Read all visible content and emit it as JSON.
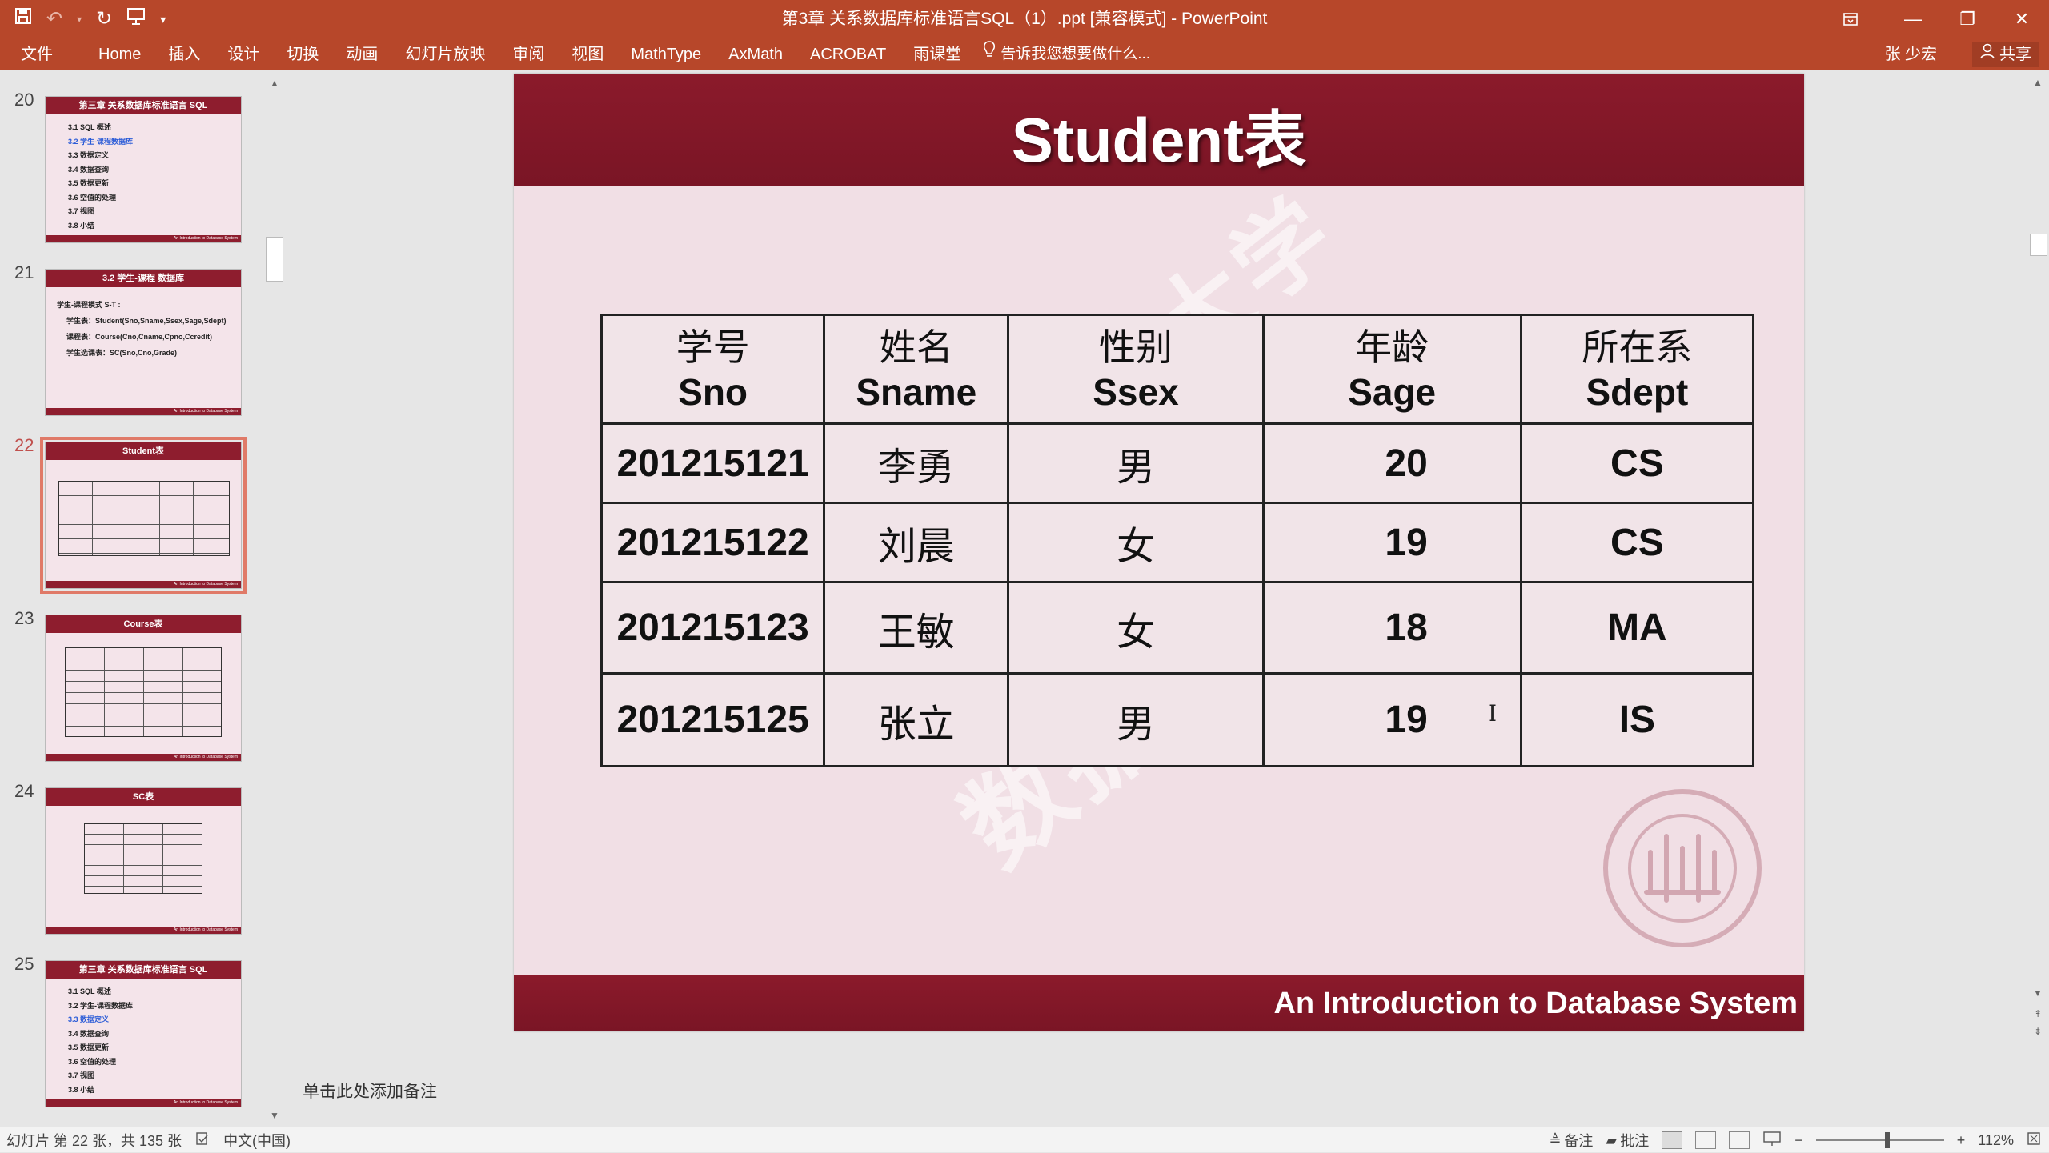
{
  "window": {
    "title": "第3章 关系数据库标准语言SQL（1）.ppt [兼容模式] - PowerPoint"
  },
  "quick_access": {
    "save": "save-icon",
    "undo": "undo-icon",
    "redo": "redo-icon",
    "present": "present-icon",
    "more": "▾"
  },
  "ribbon": {
    "tabs": [
      "文件",
      "Home",
      "插入",
      "设计",
      "切换",
      "动画",
      "幻灯片放映",
      "审阅",
      "视图",
      "MathType",
      "AxMath",
      "ACROBAT",
      "雨课堂"
    ],
    "tell_me": "告诉我您想要做什么...",
    "user": "张 少宏",
    "share": "共享"
  },
  "thumbnails": [
    {
      "number": "20",
      "title": "第三章 关系数据库标准语言 SQL",
      "lines": [
        "3.1 SQL 概述",
        "3.2 学生-课程数据库",
        "3.3 数据定义",
        "3.4 数据查询",
        "3.5 数据更新",
        "3.6 空值的处理",
        "3.7 视图",
        "3.8 小结"
      ],
      "highlight": 1
    },
    {
      "number": "21",
      "title": "3.2 学生-课程 数据库",
      "lines": [
        "学生-课程模式 S-T :",
        "学生表：Student(Sno,Sname,Ssex,Sage,Sdept)",
        "课程表：Course(Cno,Cname,Cpno,Ccredit)",
        "学生选课表：SC(Sno,Cno,Grade)"
      ]
    },
    {
      "number": "22",
      "title": "Student表",
      "active": true
    },
    {
      "number": "23",
      "title": "Course表"
    },
    {
      "number": "24",
      "title": "SC表"
    },
    {
      "number": "25",
      "title": "第三章 关系数据库标准语言 SQL",
      "lines": [
        "3.1 SQL 概述",
        "3.2 学生-课程数据库",
        "3.3 数据定义",
        "3.4 数据查询",
        "3.5 数据更新",
        "3.6 空值的处理",
        "3.7 视图",
        "3.8 小结"
      ],
      "highlight": 2
    }
  ],
  "thumb_footer": "An Introduction to Database System",
  "slide": {
    "title": "Student表",
    "footer": "An Introduction to Database System",
    "watermark_line1": "中国人民大学",
    "watermark_line2": "数据库系统概论",
    "columns": [
      {
        "cn": "学号",
        "en": "Sno"
      },
      {
        "cn": "姓名",
        "en": "Sname"
      },
      {
        "cn": "性别",
        "en": "Ssex"
      },
      {
        "cn": "年龄",
        "en": "Sage"
      },
      {
        "cn": "所在系",
        "en": "Sdept"
      }
    ],
    "rows": [
      [
        "201215121",
        "李勇",
        "男",
        "20",
        "CS"
      ],
      [
        "201215122",
        "刘晨",
        "女",
        "19",
        "CS"
      ],
      [
        "201215123",
        "王敏",
        "女",
        "18",
        "MA"
      ],
      [
        "201215125",
        "张立",
        "男",
        "19",
        "IS"
      ]
    ]
  },
  "notes": {
    "placeholder": "单击此处添加备注"
  },
  "statusbar": {
    "slide_info": "幻灯片 第 22 张，共 135 张",
    "language": "中文(中国)",
    "notes_btn": "备注",
    "comments_btn": "批注",
    "zoom": "112%"
  },
  "colors": {
    "titlebar": "#b7472a",
    "slide_band": "#8b1a2b",
    "slide_bg": "#f1dfe5"
  }
}
